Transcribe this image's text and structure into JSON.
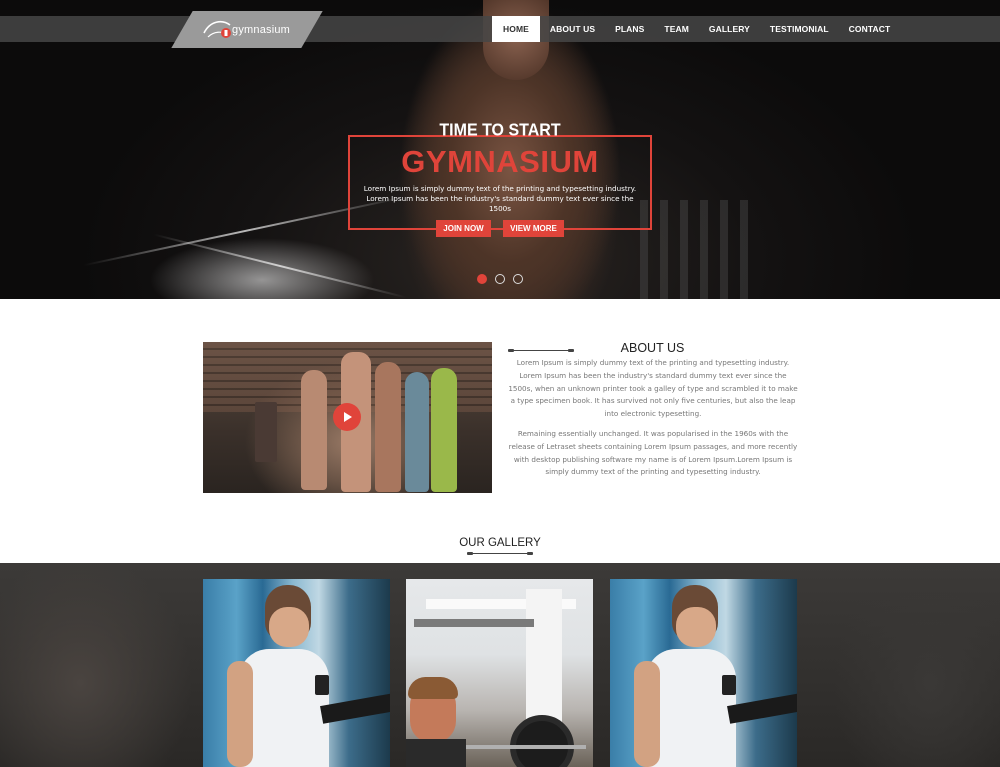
{
  "brand": {
    "logo_text": "gymnasium"
  },
  "nav": {
    "items": [
      {
        "label": "HOME",
        "active": true
      },
      {
        "label": "ABOUT US",
        "active": false
      },
      {
        "label": "PLANS",
        "active": false
      },
      {
        "label": "TEAM",
        "active": false
      },
      {
        "label": "GALLERY",
        "active": false
      },
      {
        "label": "TESTIMONIAL",
        "active": false
      },
      {
        "label": "CONTACT",
        "active": false
      }
    ]
  },
  "hero": {
    "kicker": "TIME TO START",
    "title": "GYMNASIUM",
    "text": "Lorem Ipsum is simply dummy text of the printing and typesetting industry. Lorem Ipsum has been the industry's standard dummy text ever since the 1500s",
    "join_label": "JOIN NOW",
    "more_label": "VIEW MORE",
    "slides": 3,
    "active_slide": 1
  },
  "about": {
    "title": "ABOUT US",
    "p1": "Lorem Ipsum is simply dummy text of the printing and typesetting industry. Lorem Ipsum has been the industry's standard dummy text ever since the 1500s, when an unknown printer took a galley of type and scrambled it to make a type specimen book. It has survived not only five centuries, but also the leap into electronic typesetting.",
    "p2": "Remaining essentially unchanged. It was popularised in the 1960s with the release of Letraset sheets containing Lorem Ipsum passages, and more recently with desktop publishing software my name is of Lorem Ipsum.Lorem Ipsum is simply dummy text of the printing and typesetting industry."
  },
  "gallery": {
    "title": "OUR GALLERY"
  },
  "colors": {
    "accent": "#e0443a",
    "nav_bg": "#464646",
    "text_muted": "#777777"
  },
  "icons": {
    "play": "play-icon",
    "logo": "dumbbell-logo-icon"
  }
}
